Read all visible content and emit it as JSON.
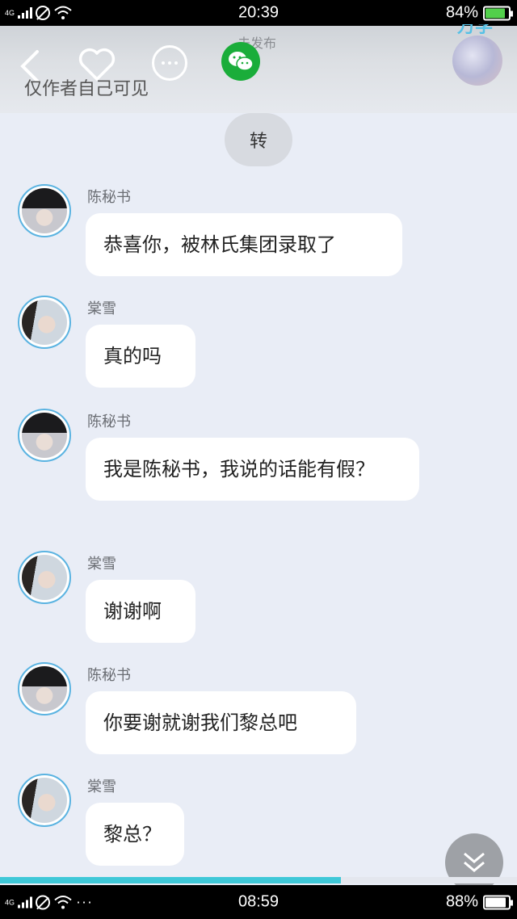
{
  "status_top": {
    "network": "4G",
    "time": "20:39",
    "battery": "84%",
    "battery_level": 0.84
  },
  "status_bottom": {
    "network": "4G",
    "time": "08:59",
    "battery": "88%",
    "battery_level": 0.88,
    "more": "···"
  },
  "header": {
    "unpublished": "未发布",
    "brand_fragment": "万学",
    "privacy": "仅作者自己可见",
    "icons": [
      "back-icon",
      "heart-icon",
      "more-icon",
      "wechat-icon"
    ]
  },
  "transfer_label": "转",
  "messages": [
    {
      "sender": "陈秘书",
      "avatar": "boy",
      "text": "恭喜你，被林氏集团录取了"
    },
    {
      "sender": "棠雪",
      "avatar": "girl",
      "text": "真的吗"
    },
    {
      "sender": "陈秘书",
      "avatar": "boy",
      "text": "我是陈秘书，我说的话能有假？"
    },
    {
      "sender": "棠雪",
      "avatar": "girl",
      "text": "谢谢啊"
    },
    {
      "sender": "陈秘书",
      "avatar": "boy",
      "text": "你要谢就谢我们黎总吧"
    },
    {
      "sender": "棠雪",
      "avatar": "girl",
      "text": "黎总？"
    }
  ],
  "reading_progress": 0.66,
  "colors": {
    "accent": "#3fc8d8",
    "wechat": "#1aad3a",
    "avatar_ring": "#5ab3e1"
  }
}
